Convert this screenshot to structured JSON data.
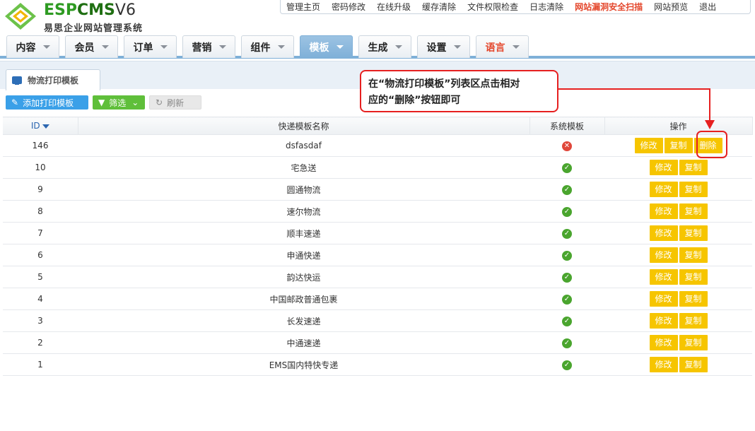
{
  "logo": {
    "brand_esp": "ESP",
    "brand_cms": "CMS",
    "brand_ver": "V6",
    "subtitle": "易思企业网站管理系统"
  },
  "top_links": [
    "管理主页",
    "密码修改",
    "在线升级",
    "缓存清除",
    "文件权限检查",
    "日志清除",
    "网站漏洞安全扫描",
    "网站预览",
    "退出"
  ],
  "top_links_warn_index": 6,
  "nav": {
    "items": [
      "内容",
      "会员",
      "订单",
      "营销",
      "组件",
      "模板",
      "生成",
      "设置",
      "语言"
    ],
    "active_index": 5,
    "highlight_index": 8,
    "colors": {
      "active_bg": "#7fb0d8",
      "lang_text": "#e4462b"
    }
  },
  "tab": {
    "label": "物流打印模板"
  },
  "toolbar": {
    "add_label": "添加打印模板",
    "filter_label": "筛选",
    "refresh_label": "刷新"
  },
  "table": {
    "headers": {
      "id": "ID",
      "name": "快递模板名称",
      "system": "系统模板",
      "action": "操作"
    },
    "rows": [
      {
        "id": "146",
        "name": "dsfasdaf",
        "system": false,
        "actions": [
          "修改",
          "复制",
          "删除"
        ]
      },
      {
        "id": "10",
        "name": "宅急送",
        "system": true,
        "actions": [
          "修改",
          "复制"
        ]
      },
      {
        "id": "9",
        "name": "圆通物流",
        "system": true,
        "actions": [
          "修改",
          "复制"
        ]
      },
      {
        "id": "8",
        "name": "速尔物流",
        "system": true,
        "actions": [
          "修改",
          "复制"
        ]
      },
      {
        "id": "7",
        "name": "顺丰速递",
        "system": true,
        "actions": [
          "修改",
          "复制"
        ]
      },
      {
        "id": "6",
        "name": "申通快递",
        "system": true,
        "actions": [
          "修改",
          "复制"
        ]
      },
      {
        "id": "5",
        "name": "韵达快运",
        "system": true,
        "actions": [
          "修改",
          "复制"
        ]
      },
      {
        "id": "4",
        "name": "中国邮政普通包裹",
        "system": true,
        "actions": [
          "修改",
          "复制"
        ]
      },
      {
        "id": "3",
        "name": "长发速递",
        "system": true,
        "actions": [
          "修改",
          "复制"
        ]
      },
      {
        "id": "2",
        "name": "中通速递",
        "system": true,
        "actions": [
          "修改",
          "复制"
        ]
      },
      {
        "id": "1",
        "name": "EMS国内特快专递",
        "system": true,
        "actions": [
          "修改",
          "复制"
        ]
      }
    ]
  },
  "callout": {
    "line1": "在“物流打印模板”列表区点击相对",
    "line2": "应的“删除”按钮即可",
    "border_color": "#e62020"
  },
  "colors": {
    "button": "#f6c500",
    "ok": "#4aa52e",
    "no": "#e0473a",
    "add_btn": "#3aa0e8",
    "filter_btn": "#5fbf3a"
  }
}
